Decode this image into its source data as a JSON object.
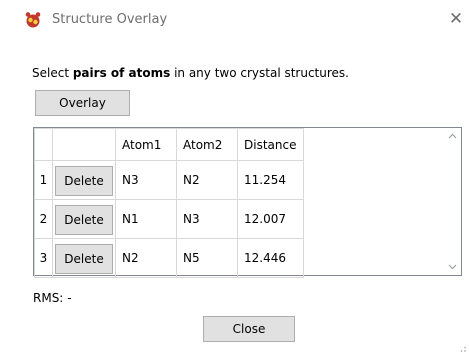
{
  "window": {
    "title": "Structure Overlay",
    "close_glyph": "✕"
  },
  "instruction": {
    "prefix": "Select ",
    "bold": "pairs of atoms",
    "suffix": " in any two crystal structures."
  },
  "overlay_button": "Overlay",
  "table": {
    "headers": [
      "",
      "",
      "Atom1",
      "Atom2",
      "Distance"
    ],
    "delete_label": "Delete",
    "rows": [
      {
        "index": "1",
        "atom1": "N3",
        "atom2": "N2",
        "distance": "11.254"
      },
      {
        "index": "2",
        "atom1": "N1",
        "atom2": "N3",
        "distance": "12.007"
      },
      {
        "index": "3",
        "atom1": "N2",
        "atom2": "N5",
        "distance": "12.446"
      }
    ],
    "scroll_up_icon": "chevron-up-icon",
    "scroll_down_icon": "chevron-down-icon"
  },
  "rms": {
    "label": "RMS:",
    "value": "-"
  },
  "close_button": "Close",
  "icons": {
    "app": "mercury-app-icon"
  }
}
